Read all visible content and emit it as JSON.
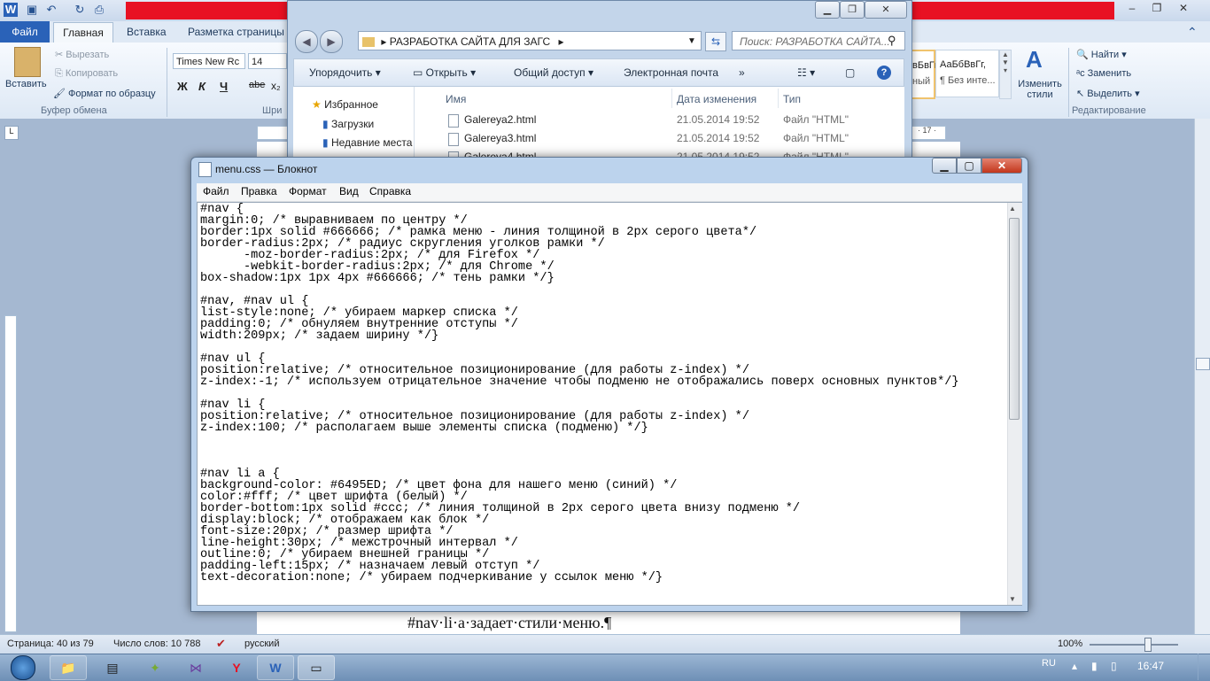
{
  "word": {
    "tabs": {
      "file": "Файл",
      "home": "Главная",
      "insert": "Вставка",
      "layout": "Разметка страницы"
    },
    "clipboard": {
      "paste": "Вставить",
      "cut": "Вырезать",
      "copy": "Копировать",
      "format_painter": "Формат по образцу",
      "group": "Буфер обмена"
    },
    "font": {
      "name": "Times New Rc",
      "size": "14",
      "group": "Шри"
    },
    "format_buttons": [
      "Ж",
      "К",
      "Ч",
      "abe",
      "x₂"
    ],
    "styles": {
      "sample1": "вБвГг,",
      "sample1_label": "ный",
      "sample2": "АаБбВвГг,",
      "sample2_label": "¶ Без инте...",
      "change": "Изменить стили"
    },
    "editing": {
      "find": "Найти",
      "replace": "Заменить",
      "select": "Выделить",
      "group": "Редактирование"
    },
    "ruler_number": "· 17 ·",
    "doc_text": "#nav·li·a·задает·стили·меню.¶",
    "status": {
      "page": "Страница: 40 из 79",
      "words": "Число слов: 10 788",
      "lang": "русский",
      "zoom": "100%"
    }
  },
  "explorer": {
    "address": "РАЗРАБОТКА САЙТА ДЛЯ ЗАГС",
    "search_placeholder": "Поиск: РАЗРАБОТКА САЙТА...",
    "toolbar": [
      "Упорядочить",
      "Открыть",
      "Общий доступ",
      "Электронная почта"
    ],
    "nav": [
      "Избранное",
      "Загрузки",
      "Недавние места"
    ],
    "headers": [
      "Имя",
      "Дата изменения",
      "Тип"
    ],
    "files": [
      {
        "name": "Galereya2.html",
        "date": "21.05.2014 19:52",
        "type": "Файл \"HTML\""
      },
      {
        "name": "Galereya3.html",
        "date": "21.05.2014 19:52",
        "type": "Файл \"HTML\""
      },
      {
        "name": "Galereya4.html",
        "date": "21.05.2014 19:52",
        "type": "Файл \"HTML\""
      }
    ]
  },
  "notepad": {
    "title": "menu.css — Блокнот",
    "menu": [
      "Файл",
      "Правка",
      "Формат",
      "Вид",
      "Справка"
    ],
    "code": "#nav {\nmargin:0; /* выравниваем по центру */\nborder:1px solid #666666; /* рамка меню - линия толщиной в 2px серого цвета*/\nborder-radius:2px; /* радиус скругления уголков рамки */\n      -moz-border-radius:2px; /* для Firefox */\n      -webkit-border-radius:2px; /* для Chrome */\nbox-shadow:1px 1px 4px #666666; /* тень рамки */}\n\n#nav, #nav ul {\nlist-style:none; /* убираем маркер списка */\npadding:0; /* обнуляем внутренние отступы */\nwidth:209px; /* задаем ширину */}\n\n#nav ul {\nposition:relative; /* относительное позиционирование (для работы z-index) */\nz-index:-1; /* используем отрицательное значение чтобы подменю не отображались поверх основных пунктов*/}\n\n#nav li {\nposition:relative; /* относительное позиционирование (для работы z-index) */\nz-index:100; /* располагаем выше элементы списка (подменю) */}\n\n\n\n#nav li a {\nbackground-color: #6495ED; /* цвет фона для нашего меню (синий) */\ncolor:#fff; /* цвет шрифта (белый) */\nborder-bottom:1px solid #ccc; /* линия толщиной в 2px серого цвета внизу подменю */\ndisplay:block; /* отображаем как блок */\nfont-size:20px; /* размер шрифта */\nline-height:30px; /* межстрочный интервал */\noutline:0; /* убираем внешней границы */\npadding-left:15px; /* назначаем левый отступ */\ntext-decoration:none; /* убираем подчеркивание у ссылок меню */}"
  },
  "taskbar": {
    "lang": "RU",
    "time": "16:47"
  },
  "colors": {
    "accent_red": "#e81123",
    "word_blue": "#2a62b8"
  }
}
